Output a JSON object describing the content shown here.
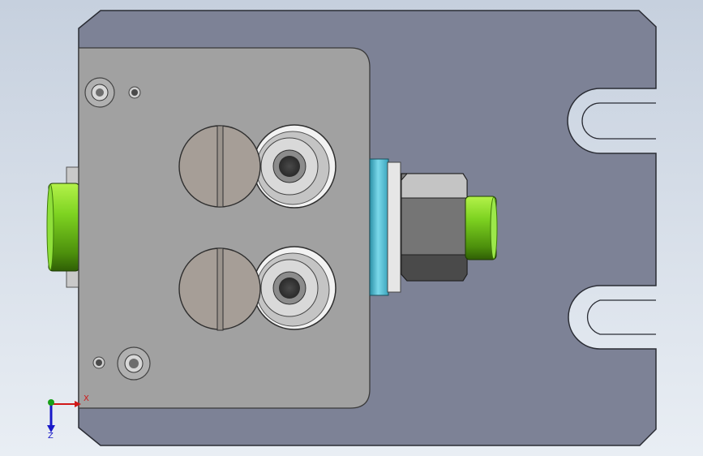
{
  "viewport": {
    "background_top": "#c6d0de",
    "background_bottom": "#e9eef4"
  },
  "colors": {
    "base_plate": "#7d8296",
    "base_plate_edge": "#2a2c34",
    "cover_plate": "#a1a1a1",
    "cover_plate_edge": "#3a3a3a",
    "cap_screw": "#a69e97",
    "counterbore": "#c9c9c9",
    "fitting_green": "#7ed321",
    "seal_cyan": "#5fc9dc",
    "hex_nut": "#7f7f7f"
  },
  "triad": {
    "x_label": "X",
    "z_label": "Z",
    "x_color": "#d01818",
    "y_color": "#18a018",
    "z_color": "#1818c8"
  }
}
